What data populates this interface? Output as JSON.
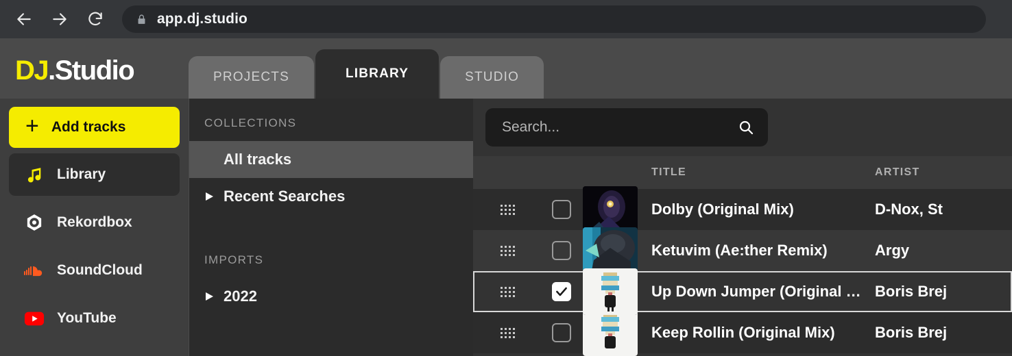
{
  "browser": {
    "back_icon": "arrow-left-icon",
    "forward_icon": "arrow-right-icon",
    "reload_icon": "reload-icon",
    "lock_icon": "lock-icon",
    "url": "app.dj.studio"
  },
  "header": {
    "logo_mark": "DJ",
    "logo_name": ".Studio",
    "tabs": [
      {
        "label": "PROJECTS",
        "active": false
      },
      {
        "label": "LIBRARY",
        "active": true
      },
      {
        "label": "STUDIO",
        "active": false
      }
    ]
  },
  "sidebar": {
    "add_tracks": {
      "label": "Add tracks",
      "icon": "plus-icon",
      "accent": "#f5ec00"
    },
    "items": [
      {
        "label": "Library",
        "icon": "music-note-icon",
        "active": true
      },
      {
        "label": "Rekordbox",
        "icon": "rekordbox-icon",
        "active": false
      },
      {
        "label": "SoundCloud",
        "icon": "soundcloud-icon",
        "active": false
      },
      {
        "label": "YouTube",
        "icon": "youtube-icon",
        "active": false
      }
    ]
  },
  "collections": {
    "section_collections": "COLLECTIONS",
    "section_imports": "IMPORTS",
    "items": [
      {
        "label": "All tracks",
        "selected": true,
        "expandable": false
      },
      {
        "label": "Recent Searches",
        "selected": false,
        "expandable": true
      }
    ],
    "imports": [
      {
        "label": "2022",
        "selected": false,
        "expandable": true
      }
    ]
  },
  "main": {
    "search": {
      "placeholder": "Search...",
      "value": "",
      "icon": "search-icon"
    },
    "columns": {
      "title": "TITLE",
      "artist": "ARTIST"
    },
    "tracks": [
      {
        "title": "Dolby (Original Mix)",
        "artist": "D-Nox, St",
        "checked": false,
        "selected": false,
        "art": "dark-glow"
      },
      {
        "title": "Ketuvim (Ae:ther Remix)",
        "artist": "Argy",
        "checked": false,
        "selected": false,
        "art": "teal-creature"
      },
      {
        "title": "Up Down Jumper (Original …",
        "artist": "Boris Brej",
        "checked": true,
        "selected": true,
        "art": "pixel-character"
      },
      {
        "title": "Keep Rollin (Original Mix)",
        "artist": "Boris Brej",
        "checked": false,
        "selected": false,
        "art": "pixel-character"
      }
    ]
  },
  "colors": {
    "brand_yellow": "#f5ec00",
    "soundcloud_orange": "#ff5500",
    "youtube_red": "#ff0000",
    "panel_dark": "#2d2d2d",
    "sidebar_gray": "#3e3e3e"
  }
}
